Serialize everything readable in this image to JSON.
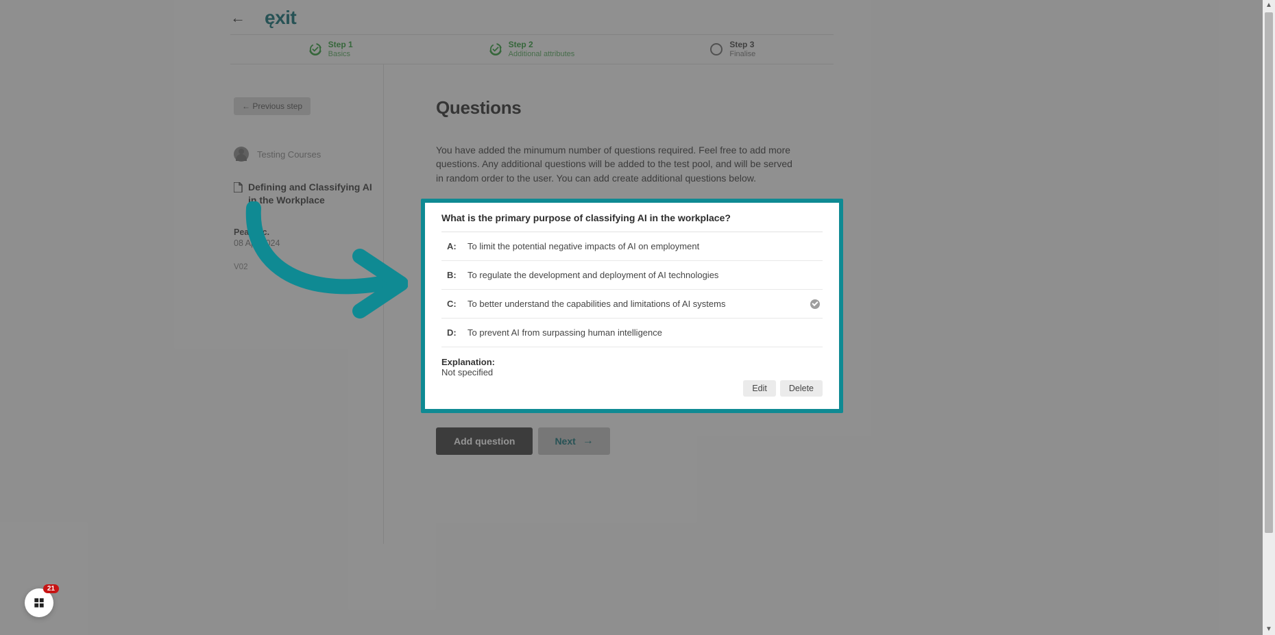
{
  "brand": "ęxit",
  "stepper": [
    {
      "title": "Step 1",
      "subtitle": "Basics",
      "state": "done"
    },
    {
      "title": "Step 2",
      "subtitle": "Additional attributes",
      "state": "done"
    },
    {
      "title": "Step 3",
      "subtitle": "Finalise",
      "state": "pending"
    }
  ],
  "left_panel": {
    "prev_button": "← Previous step",
    "author": "Testing Courses",
    "course_title": "Defining and Classifying AI in the Workplace",
    "org": "Pear Inc.",
    "date": "08 Apr 2024",
    "version": "V02"
  },
  "questions_section": {
    "heading": "Questions",
    "intro": "You have added the minumum number of questions required. Feel free to add more questions. Any additional questions will be added to the test pool, and will be served in random order to the user. You can add create additional questions below."
  },
  "question_card": {
    "prompt": "What is the primary purpose of classifying AI in the workplace?",
    "answers": [
      {
        "letter": "A:",
        "text": "To limit the potential negative impacts of AI on employment",
        "correct": false
      },
      {
        "letter": "B:",
        "text": "To regulate the development and deployment of AI technologies",
        "correct": false
      },
      {
        "letter": "C:",
        "text": "To better understand the capabilities and limitations of AI systems",
        "correct": true
      },
      {
        "letter": "D:",
        "text": "To prevent AI from surpassing human intelligence",
        "correct": false
      }
    ],
    "explanation_label": "Explanation:",
    "explanation_value": "Not specified",
    "edit_label": "Edit",
    "delete_label": "Delete"
  },
  "bottom_actions": {
    "add_question": "Add question",
    "next": "Next"
  },
  "help_bubble": {
    "count": "21"
  },
  "colors": {
    "teal": "#0f8a93",
    "brand": "#0e6e74",
    "green": "#2f9b3a"
  }
}
